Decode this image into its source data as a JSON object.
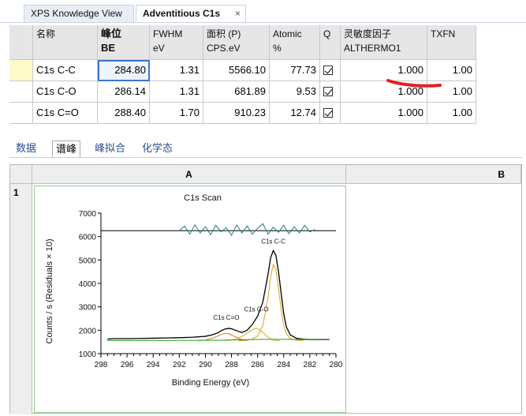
{
  "tabs": [
    {
      "label": "XPS Knowledge View"
    },
    {
      "label": "Adventitious C1s",
      "close": "×"
    }
  ],
  "peak_table": {
    "headers": [
      {
        "line1": "名称",
        "line2": ""
      },
      {
        "line1": "峰位",
        "line2": "BE"
      },
      {
        "line1": "FWHM",
        "line2": "eV"
      },
      {
        "line1": "面积 (P)",
        "line2": "CPS.eV"
      },
      {
        "line1": "Atomic",
        "line2": "%"
      },
      {
        "line1": "Q",
        "line2": ""
      },
      {
        "line1": "灵敏度因子",
        "line2": "ALTHERMO1"
      },
      {
        "line1": "TXFN",
        "line2": ""
      }
    ],
    "rows": [
      {
        "name": "C1s C-C",
        "be": "284.80",
        "fwhm": "1.31",
        "area": "5566.10",
        "atomic": "77.73",
        "sf": "1.000",
        "txfn": "1.00"
      },
      {
        "name": "C1s C-O",
        "be": "286.14",
        "fwhm": "1.31",
        "area": "681.89",
        "atomic": "9.53",
        "sf": "1.000",
        "txfn": "1.00"
      },
      {
        "name": "C1s C=O",
        "be": "288.40",
        "fwhm": "1.70",
        "area": "910.23",
        "atomic": "12.74",
        "sf": "1.000",
        "txfn": "1.00"
      }
    ]
  },
  "modes": [
    "数据",
    "谱峰",
    "峰拟合",
    "化学态"
  ],
  "active_mode": "谱峰",
  "sheet": {
    "col_a": "A",
    "col_b": "B",
    "row_1": "1"
  },
  "annotation_color": "#e02020",
  "chart_data": {
    "type": "line",
    "title": "C1s Scan",
    "xlabel": "Binding Energy (eV)",
    "ylabel": "Counts / s  (Residuals × 10)",
    "xlim": [
      298,
      280
    ],
    "ylim": [
      1000,
      7000
    ],
    "xticks": [
      298,
      296,
      294,
      292,
      290,
      288,
      286,
      284,
      282,
      280
    ],
    "yticks": [
      1000,
      2000,
      3000,
      4000,
      5000,
      6000,
      7000
    ],
    "residual_baseline": 6250,
    "peak_labels": [
      {
        "text": "C1s C-C",
        "x": 284.8,
        "y": 5700
      },
      {
        "text": "C1s C-O",
        "x": 286.1,
        "y": 2800
      },
      {
        "text": "C1s C=O",
        "x": 288.4,
        "y": 2450
      }
    ],
    "series": [
      {
        "name": "envelope",
        "color": "#000000",
        "x": [
          297.5,
          297,
          296,
          295,
          294,
          293,
          292,
          291,
          290,
          289.5,
          289,
          288.8,
          288.5,
          288.2,
          288,
          287.6,
          287.2,
          286.8,
          286.4,
          286,
          285.6,
          285.2,
          285,
          284.8,
          284.6,
          284.4,
          284.2,
          284,
          283.8,
          283.5,
          283,
          282.5,
          282,
          281,
          280.5
        ],
        "y": [
          1620,
          1640,
          1640,
          1650,
          1660,
          1670,
          1680,
          1700,
          1740,
          1800,
          1900,
          1980,
          2050,
          2080,
          2060,
          1980,
          1900,
          2000,
          2250,
          2600,
          3200,
          4400,
          5100,
          5400,
          5200,
          4500,
          3600,
          2700,
          2150,
          1800,
          1650,
          1620,
          1600,
          1600,
          1600
        ]
      },
      {
        "name": "C-C",
        "color": "#e0a020",
        "x": [
          287.5,
          287,
          286.5,
          286,
          285.6,
          285.2,
          285,
          284.8,
          284.6,
          284.4,
          284.2,
          284,
          283.8,
          283.5,
          283,
          282.5
        ],
        "y": [
          1550,
          1560,
          1600,
          1750,
          2200,
          3400,
          4300,
          4800,
          4600,
          3800,
          2900,
          2200,
          1850,
          1650,
          1570,
          1550
        ]
      },
      {
        "name": "C-O",
        "color": "#c8b420",
        "x": [
          288.5,
          288,
          287.5,
          287,
          286.6,
          286.3,
          286.1,
          285.9,
          285.6,
          285.2,
          284.8,
          284.3
        ],
        "y": [
          1550,
          1580,
          1650,
          1800,
          1950,
          2050,
          2080,
          2040,
          1900,
          1700,
          1580,
          1550
        ]
      },
      {
        "name": "C=O",
        "color": "#d07820",
        "x": [
          290.5,
          290,
          289.5,
          289,
          288.7,
          288.4,
          288.1,
          287.8,
          287.3,
          286.8
        ],
        "y": [
          1550,
          1580,
          1650,
          1760,
          1840,
          1870,
          1830,
          1740,
          1620,
          1560
        ]
      },
      {
        "name": "background",
        "color": "#20a020",
        "x": [
          297.5,
          292,
          290,
          289,
          288,
          287,
          286,
          285,
          284,
          283,
          282,
          280.5
        ],
        "y": [
          1560,
          1565,
          1570,
          1575,
          1585,
          1595,
          1605,
          1610,
          1610,
          1605,
          1600,
          1595
        ]
      },
      {
        "name": "residuals",
        "color": "#208080",
        "x": [
          292,
          291.6,
          291.2,
          290.8,
          290.4,
          290,
          289.6,
          289.2,
          288.8,
          288.4,
          288,
          287.6,
          287.2,
          286.8,
          286.4,
          286,
          285.6,
          285.2,
          284.8,
          284.4,
          284,
          283.6,
          283.2,
          282.8,
          282.4,
          282,
          281.6
        ],
        "y": [
          6250,
          6450,
          6100,
          6500,
          6150,
          6420,
          6080,
          6480,
          6200,
          6380,
          6050,
          6500,
          6150,
          6450,
          6100,
          6350,
          6550,
          6100,
          6400,
          6180,
          6480,
          6120,
          6420,
          6150,
          6480,
          6200,
          6300
        ]
      }
    ]
  }
}
